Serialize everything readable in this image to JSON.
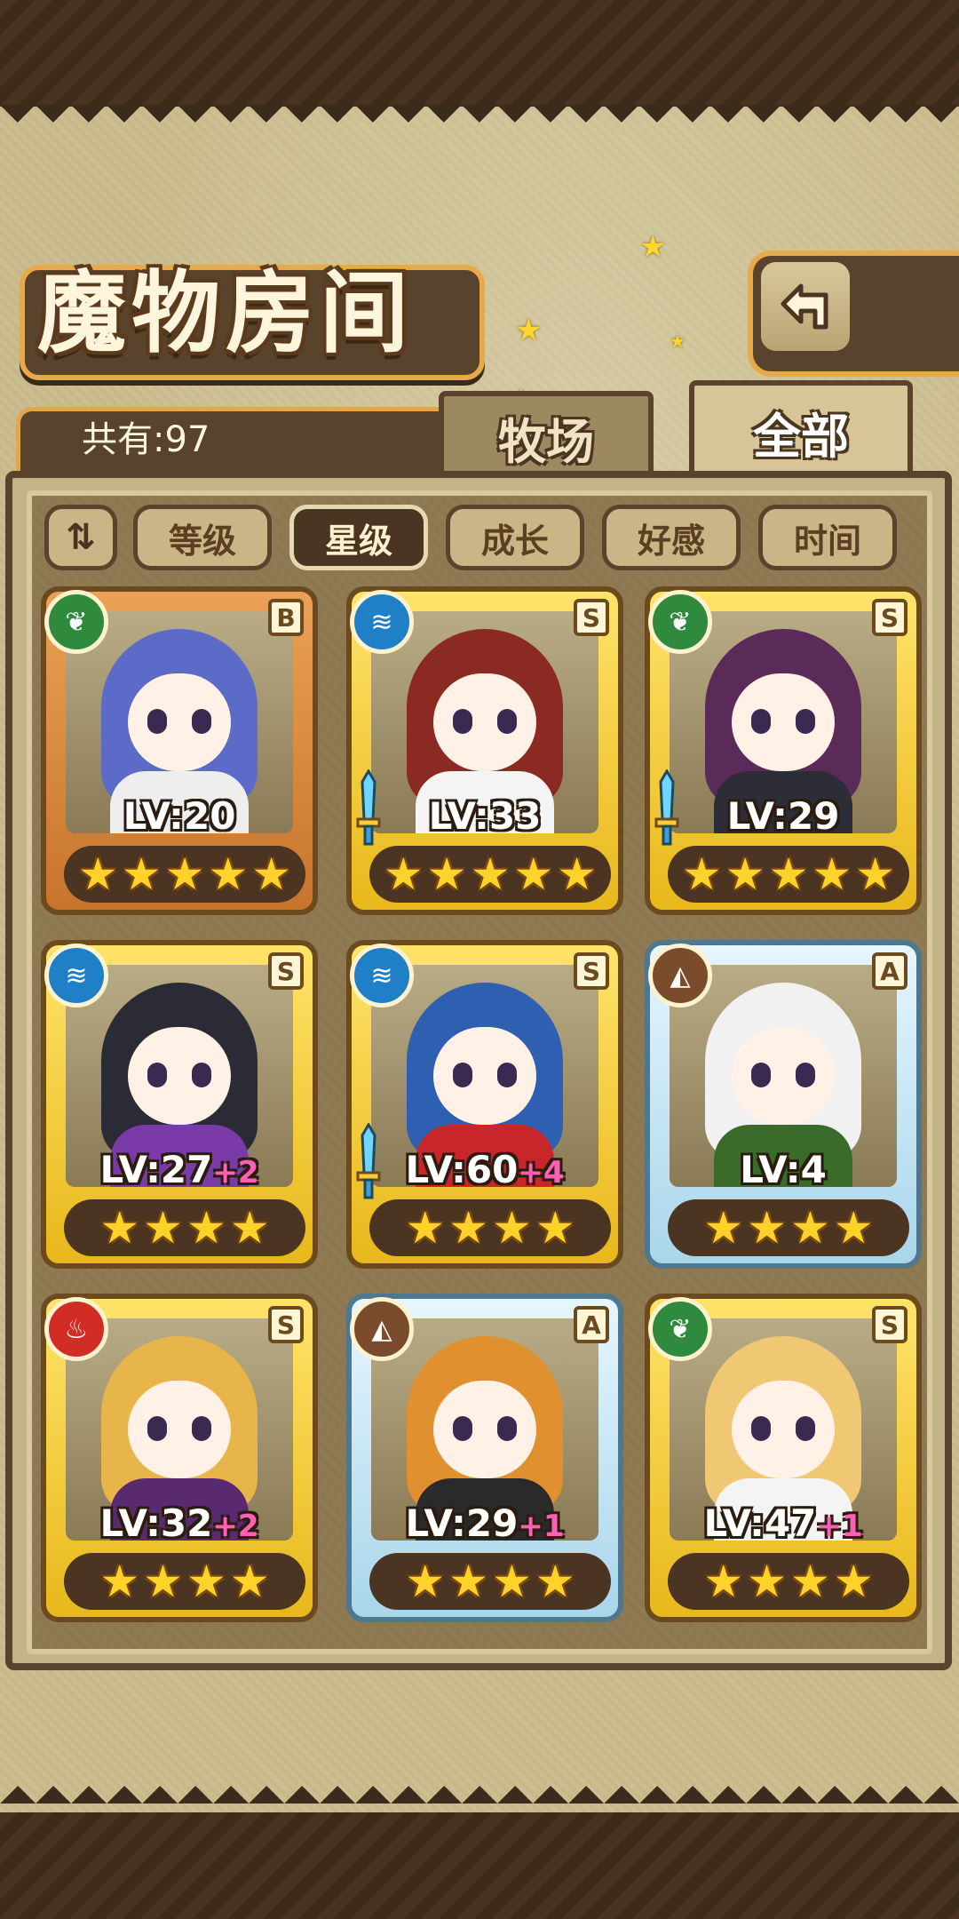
{
  "title": "魔物房间",
  "count_label": "共有:97",
  "tabs": [
    {
      "label": "牧场",
      "active": false
    },
    {
      "label": "全部",
      "active": true
    }
  ],
  "sort_buttons": [
    {
      "label": "等级",
      "active": false
    },
    {
      "label": "星级",
      "active": true
    },
    {
      "label": "成长",
      "active": false
    },
    {
      "label": "好感",
      "active": false
    },
    {
      "label": "时间",
      "active": false
    }
  ],
  "monsters": [
    {
      "element": "leaf",
      "rank": "B",
      "level": "LV:20",
      "plus": "",
      "stars": 5,
      "frame": "bronze",
      "hair": "#5b6bc7",
      "body": "#eeeeee",
      "sword": false
    },
    {
      "element": "water",
      "rank": "S",
      "level": "LV:33",
      "plus": "",
      "stars": 5,
      "frame": "gold",
      "hair": "#8a2a22",
      "body": "#f4f4f4",
      "sword": true
    },
    {
      "element": "leaf",
      "rank": "S",
      "level": "LV:29",
      "plus": "",
      "stars": 5,
      "frame": "gold",
      "hair": "#5a2a58",
      "body": "#2d2d38",
      "sword": true
    },
    {
      "element": "water",
      "rank": "S",
      "level": "LV:27",
      "plus": "+2",
      "stars": 4,
      "frame": "gold",
      "hair": "#2b2b35",
      "body": "#7a3aa8",
      "sword": false
    },
    {
      "element": "water",
      "rank": "S",
      "level": "LV:60",
      "plus": "+4",
      "stars": 4,
      "frame": "gold",
      "hair": "#2f5fb0",
      "body": "#c8262a",
      "sword": true
    },
    {
      "element": "earth",
      "rank": "A",
      "level": "LV:4",
      "plus": "",
      "stars": 4,
      "frame": "ice",
      "hair": "#f1f1f1",
      "body": "#3a6b2a",
      "sword": false
    },
    {
      "element": "fire",
      "rank": "S",
      "level": "LV:32",
      "plus": "+2",
      "stars": 4,
      "frame": "gold",
      "hair": "#e8b54a",
      "body": "#5a2a70",
      "sword": false
    },
    {
      "element": "earth",
      "rank": "A",
      "level": "LV:29",
      "plus": "+1",
      "stars": 4,
      "frame": "ice",
      "hair": "#e0902e",
      "body": "#2a2a2a",
      "sword": false
    },
    {
      "element": "leaf",
      "rank": "S",
      "level": "LV:47",
      "plus": "+1",
      "stars": 4,
      "frame": "gold",
      "hair": "#f0c874",
      "body": "#f4f4f4",
      "sword": false
    }
  ],
  "icons": {
    "back": "back-arrow-icon",
    "sort_toggle": "sort-order-icon",
    "star": "★"
  }
}
